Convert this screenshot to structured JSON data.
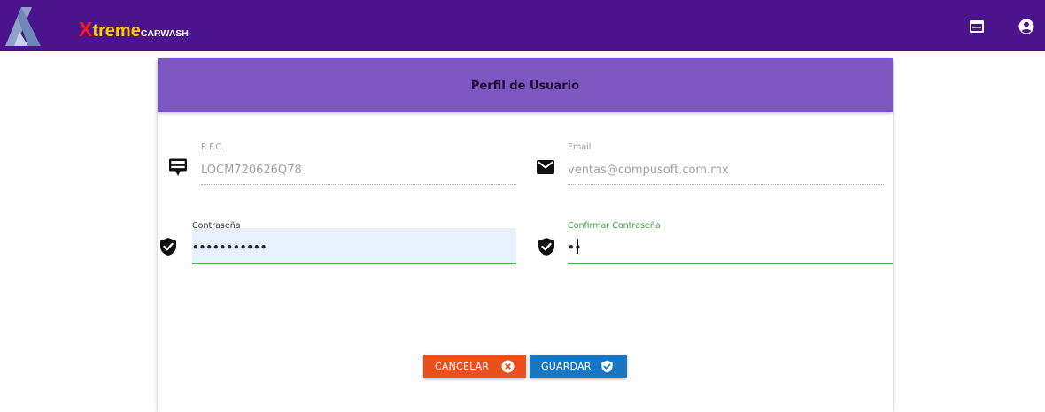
{
  "brand": {
    "x": "X",
    "treme": "treme",
    "carwash": "CARWASH"
  },
  "header": {
    "icons": [
      "window-icon",
      "user-account-icon"
    ]
  },
  "card": {
    "title": "Perfil de Usuario"
  },
  "fields": {
    "rfc": {
      "label": "R.F.C.",
      "value": "LOCM720626Q78",
      "icon": "id-badge-icon"
    },
    "email": {
      "label": "Email",
      "value": "ventas@compusoft.com.mx",
      "icon": "envelope-icon"
    },
    "password": {
      "label": "Contraseña",
      "value": "•••••••••••",
      "icon": "shield-check-icon"
    },
    "confirm_password": {
      "label": "Confirmar Contraseña",
      "value": "••",
      "icon": "shield-check-icon"
    }
  },
  "buttons": {
    "cancel": "CANCELAR",
    "save": "GUARDAR"
  },
  "colors": {
    "topbar": "#4b148c",
    "card_header": "#7e57c2",
    "cancel": "#e8501e",
    "save": "#1977c2",
    "focus_line": "#4caf50",
    "autofill_bg": "#e8f0fe"
  }
}
